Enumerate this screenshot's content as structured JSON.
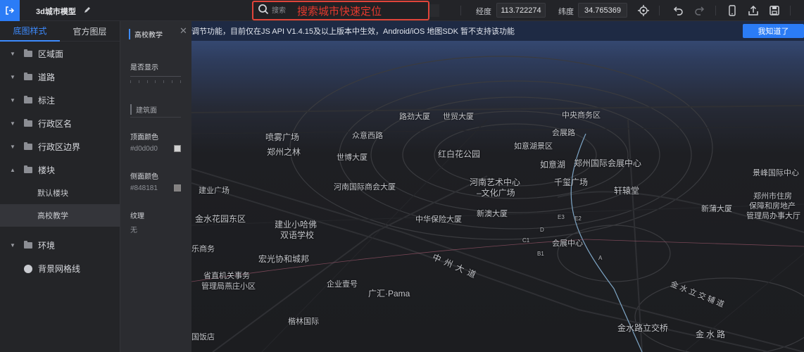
{
  "header": {
    "title": "3d城市模型",
    "search_placeholder": "搜索",
    "search_hint": "搜索城市快速定位",
    "longitude_label": "经度",
    "longitude_value": "113.722274",
    "latitude_label": "纬度",
    "latitude_value": "34.765369"
  },
  "sidebar": {
    "tabs": [
      "底图样式",
      "官方图层"
    ],
    "items": [
      {
        "label": "区域面"
      },
      {
        "label": "道路"
      },
      {
        "label": "标注"
      },
      {
        "label": "行政区名"
      },
      {
        "label": "行政区边界"
      },
      {
        "label": "楼块"
      }
    ],
    "sub_items": [
      "默认楼块",
      "高校教学"
    ],
    "items_bottom": [
      {
        "label": "环境"
      },
      {
        "label": "背景网格线"
      }
    ]
  },
  "panel": {
    "title": "高校教学",
    "show_label": "是否显示",
    "section": "建筑面",
    "top_color_label": "顶面颜色",
    "top_color_value": "#d0d0d0",
    "side_color_label": "侧面颜色",
    "side_color_value": "#848181",
    "texture_label": "纹理",
    "texture_value": "无"
  },
  "notice": {
    "text": "调节功能，目前仅在JS API V1.4.15及以上版本中生效，Android/iOS 地图SDK 暂不支持该功能",
    "button": "我知道了"
  },
  "map_labels": [
    "路劲大厦",
    "世贸大厦",
    "中央商务区",
    "会展路",
    "喷雾广场",
    "众意西路",
    "郑州之林",
    "如意湖景区",
    "世博大厦",
    "红白花公园",
    "如意湖",
    "郑州国际会展中心",
    "景峰国际中心",
    "建业广场",
    "河南国际商会大厦",
    "河南艺术中心",
    "–文化广场",
    "千玺广场",
    "轩辕堂",
    "郑州市住房",
    "保障和房地产",
    "管理局办事大厅",
    "新蒲大厦",
    "金水花园东区",
    "新澳大厦",
    "中华保险大厦",
    "建业小哈佛",
    "双语学校",
    "会展中心",
    "乐商务",
    "宏光协和城邦",
    "中州大道",
    "省直机关事务",
    "管理局燕庄小区",
    "企业壹号",
    "广汇·Pama",
    "金水立交辅道",
    "楷林国际",
    "金水路立交桥",
    "金水路",
    "国饭店",
    "D",
    "E3",
    "E2",
    "C1",
    "B1",
    "A"
  ]
}
